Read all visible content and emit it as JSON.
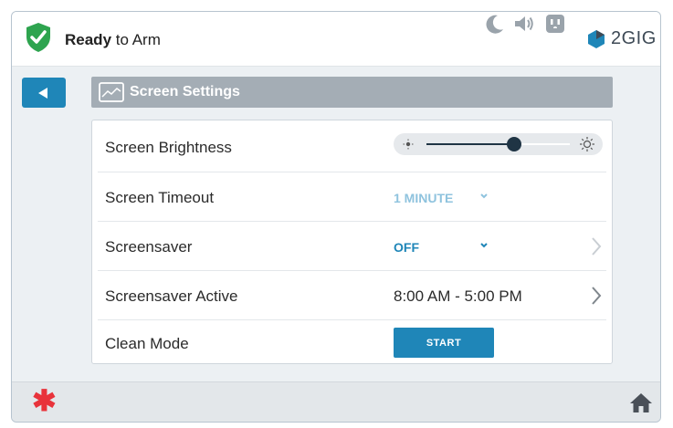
{
  "status": {
    "bold": "Ready",
    "rest": " to Arm",
    "color": "#2ea44f"
  },
  "topbar_icons": [
    "moon-icon",
    "speaker-icon",
    "outlet-icon",
    "stop-icon"
  ],
  "brand": {
    "text": "2GIG",
    "icon": "logo-icon"
  },
  "header": {
    "title": "Screen Settings",
    "icon": "screen-icon"
  },
  "settings": {
    "brightness": {
      "label": "Screen Brightness",
      "level": 0.61
    },
    "timeout": {
      "label": "Screen Timeout",
      "value": "1 MINUTE"
    },
    "screensaver": {
      "label": "Screensaver",
      "value": "OFF"
    },
    "active": {
      "label": "Screensaver Active",
      "value": "8:00 AM - 5:00 PM"
    },
    "clean": {
      "label": "Clean Mode",
      "button": "START"
    }
  },
  "colors": {
    "accent": "#1f86b8",
    "header_bar": "#a4adb5",
    "alert": "#e8333b",
    "slider_knob": "#1f3444"
  }
}
